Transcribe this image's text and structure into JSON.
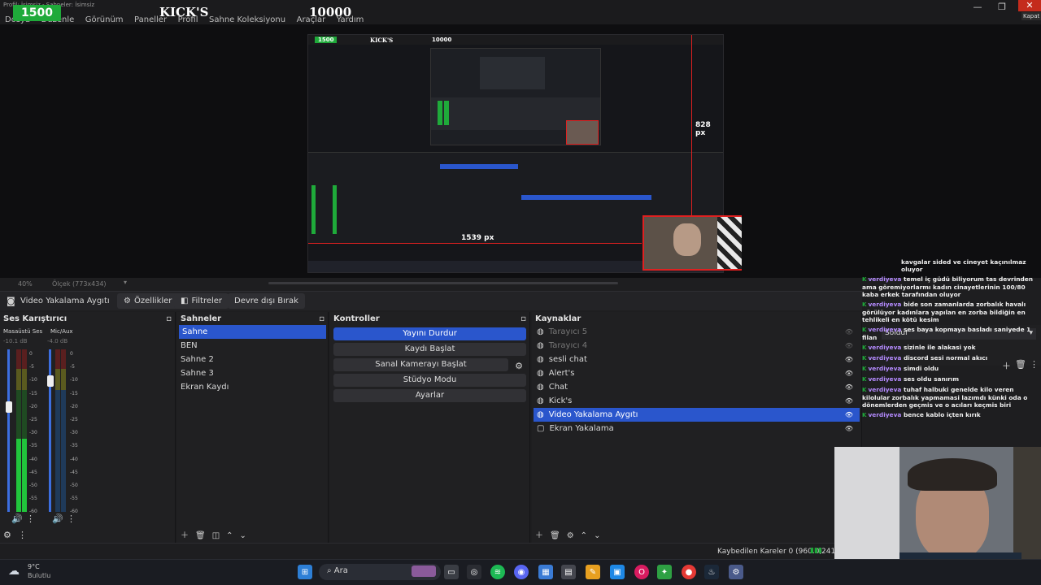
{
  "titlebar": {
    "app_title": "Profil: İsimsiz - Sahneler: İsimsiz",
    "menu": [
      "Dosya",
      "Düzenle",
      "Görünüm",
      "Paneller",
      "Profil",
      "Sahne Koleksiyonu",
      "Araçlar",
      "Yardım"
    ],
    "overlay_count_1": "1500",
    "overlay_brand": "KICK'S",
    "overlay_count_2": "10000",
    "close_tooltip": "Kapat"
  },
  "preview": {
    "mini_count_1": "1500",
    "mini_brand": "KICK'S",
    "mini_count_2": "10000",
    "height_label": "828 px",
    "width_label": "1539 px"
  },
  "preview_status": {
    "zoom": "40%",
    "size_label": "Ölçek (773x434)"
  },
  "source_toolbar": {
    "source_name": "Video Yakalama Aygıtı",
    "properties": "Özellikler",
    "filters": "Filtreler",
    "deactivate": "Devre dışı Bırak"
  },
  "audio_mixer": {
    "title": "Ses Karıştırıcı",
    "channels": [
      {
        "name": "Masaüstü Ses",
        "db": "-10.1 dB"
      },
      {
        "name": "Mic/Aux",
        "db": "-4.0 dB"
      }
    ],
    "scale": [
      "0",
      "-5",
      "-10",
      "-15",
      "-20",
      "-25",
      "-30",
      "-35",
      "-40",
      "-45",
      "-50",
      "-55",
      "-60"
    ]
  },
  "scenes": {
    "title": "Sahneler",
    "items": [
      "Sahne",
      "BEN",
      "Sahne 2",
      "Sahne 3",
      "Ekran Kaydı"
    ],
    "selected_index": 0
  },
  "controls": {
    "title": "Kontroller",
    "buttons": [
      "Yayını Durdur",
      "Kaydı Başlat",
      "Sanal Kamerayı Başlat",
      "Stüdyo Modu",
      "Ayarlar"
    ]
  },
  "sources": {
    "title": "Kaynaklar",
    "items": [
      {
        "name": "Tarayıcı 5",
        "dim": true
      },
      {
        "name": "Tarayıcı 4",
        "dim": true
      },
      {
        "name": "sesli chat",
        "dim": false
      },
      {
        "name": "Alert's",
        "dim": false
      },
      {
        "name": "Chat",
        "dim": false
      },
      {
        "name": "Kick's",
        "dim": false
      },
      {
        "name": "Video Yakalama Aygıtı",
        "dim": false
      },
      {
        "name": "Ekran Yakalama",
        "dim": false
      }
    ],
    "selected_index": 6
  },
  "side_panel": {
    "label": "Soldur"
  },
  "chat": [
    {
      "user": "",
      "text": "kavgalar sided ve cineyet kaçınılmaz oluyor"
    },
    {
      "user": "verdiyeva",
      "text": "temel iç güdü biliyorum tas devrinden ama göremiyorlarmı kadın cinayetlerinin 100/80 kaba erkek tarafından oluyor"
    },
    {
      "user": "verdiyeva",
      "text": "bide son zamanlarda zorbalık havalı görülüyor kadınlara yapılan en zorba bildiğin en tehlikeli en kötü kesim"
    },
    {
      "user": "verdiyeva",
      "text": "ses baya kopmaya basladı saniyede 1 filan"
    },
    {
      "user": "verdiyeva",
      "text": "sizinle ile alakasi yok"
    },
    {
      "user": "verdiyeva",
      "text": "discord sesi normal akıcı"
    },
    {
      "user": "verdiyeva",
      "text": "simdi oldu"
    },
    {
      "user": "verdiyeva",
      "text": "ses oldu sanırım"
    },
    {
      "user": "verdiyeva",
      "text": "tuhaf halbuki genelde kilo veren kilolular zorbalık yapmamasi lazımdı künki oda o dönemlerden geçmis ve o acıları keçmis biri"
    },
    {
      "user": "verdiyeva",
      "text": "bence kablo içten kırık"
    }
  ],
  "status_bar": {
    "dropped_frames": "Kaybedilen Kareler 0 (960.0)",
    "bitrate": "2418"
  },
  "taskbar": {
    "temperature": "9°C",
    "weather": "Bulutlu",
    "search": "Ara"
  }
}
